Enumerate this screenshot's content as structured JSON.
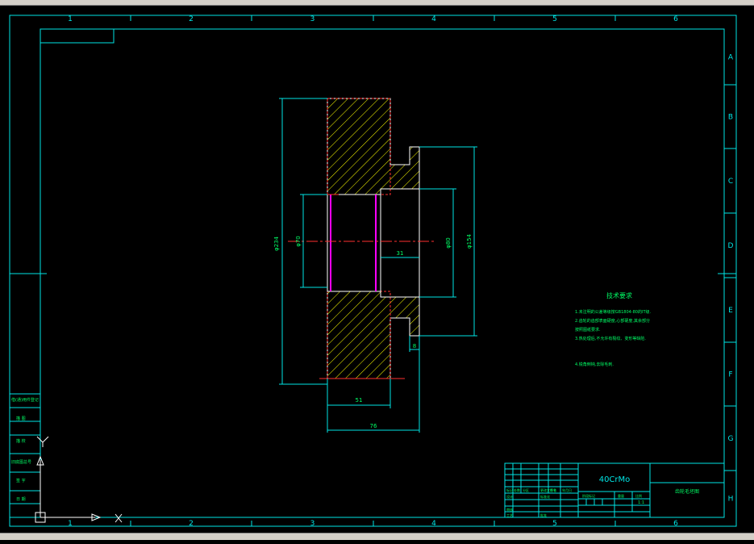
{
  "colors": {
    "background": "#000000",
    "frame": "#00e5e5",
    "outline": "#ffffff",
    "hatch": "#ffff00",
    "hole": "#ff00ff",
    "centerline": "#ff3030",
    "text": "#00ff66"
  },
  "grid": {
    "columns": [
      "1",
      "2",
      "3",
      "4",
      "5",
      "6"
    ],
    "rows": [
      "A",
      "B",
      "C",
      "D",
      "E",
      "F",
      "G",
      "H"
    ]
  },
  "dimensions": {
    "outer_dia": "φ234",
    "bore_dia": "φ70",
    "recess_dia": "φ80",
    "hub_dia": "φ154",
    "recess_depth": "31",
    "hub_step": "8",
    "rim_width": "51",
    "total_width": "76"
  },
  "notes": {
    "title": "技术要求",
    "lines": [
      "1.未注明的公差等级按GB1804-80的IT级.",
      "2.齿轮的齿部表面硬度,心部硬度,其余部分",
      "按照图纸要求.",
      "3.热处理后,不允许有裂纹、变形等缺陷.",
      "4.锐角倒钝,去除毛刺."
    ]
  },
  "title_block": {
    "material": "40CrMo",
    "drawing_name": "齿轮毛坯图",
    "scale": "1:1",
    "fields": [
      "标记",
      "处数",
      "分区",
      "更改文件号",
      "签名",
      "年月日",
      "设计",
      "标准化",
      "审核",
      "工艺",
      "批准",
      "阶段标记",
      "重量",
      "比例"
    ]
  },
  "side_block": [
    "借(通)用件登记",
    "描 图",
    "描 校",
    "旧底图总号",
    "签 字",
    "日 期"
  ],
  "ucs": {
    "x_label": "X",
    "y_label": "Y"
  }
}
